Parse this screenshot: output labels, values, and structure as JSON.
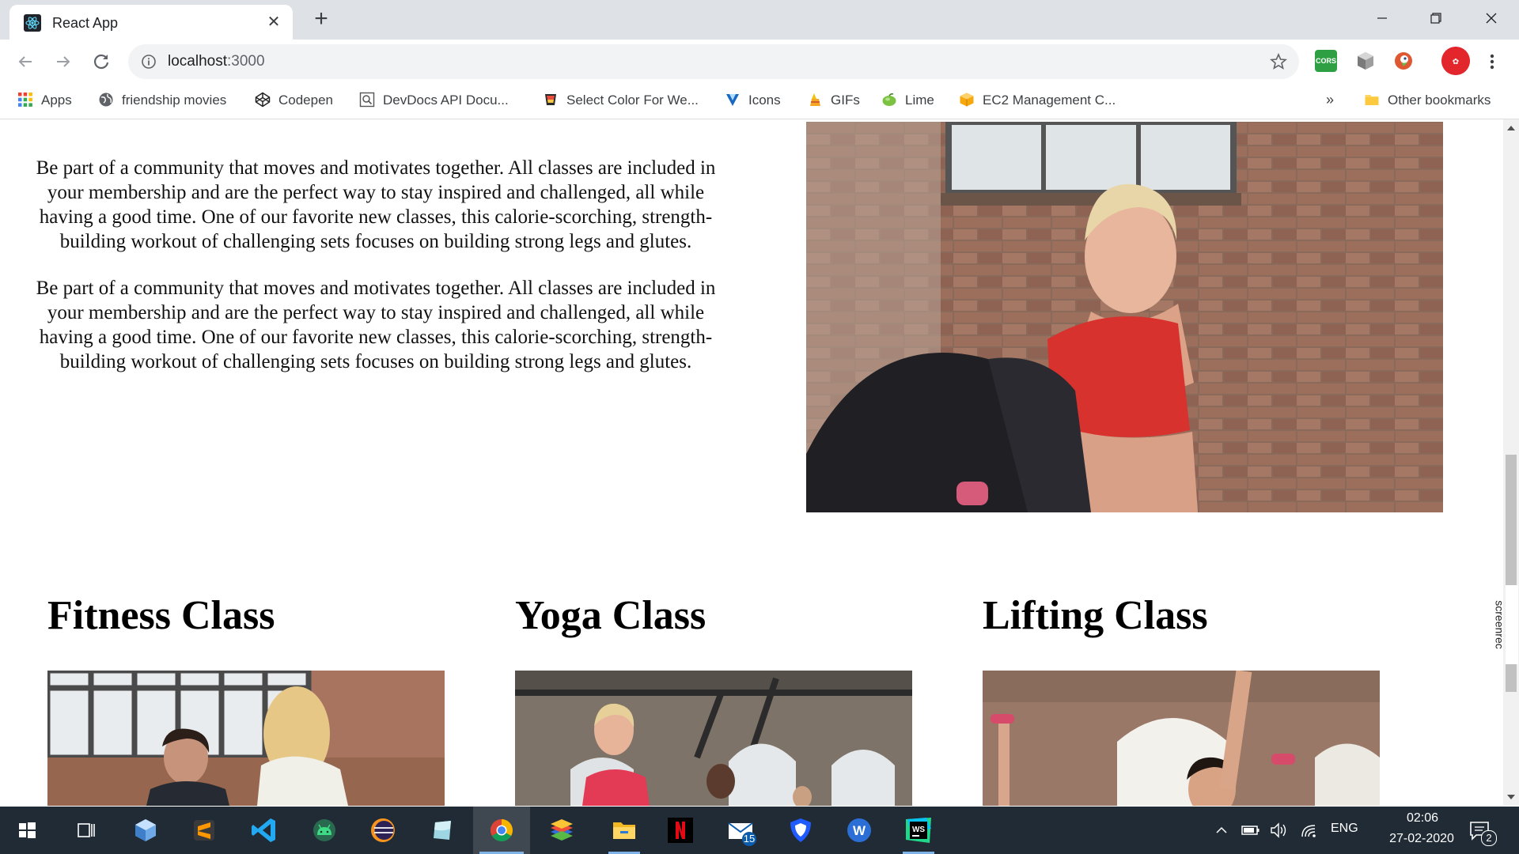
{
  "browser": {
    "tab_title": "React App",
    "url_host": "localhost",
    "url_port": ":3000"
  },
  "extensions": {
    "cors_label": "CORS"
  },
  "bookmarks": [
    {
      "label": "Apps",
      "icon": "apps-grid-icon"
    },
    {
      "label": "friendship movies",
      "icon": "globe-icon"
    },
    {
      "label": "Codepen",
      "icon": "codepen-icon"
    },
    {
      "label": "DevDocs API Docu...",
      "icon": "devdocs-icon"
    },
    {
      "label": "Select Color For We...",
      "icon": "color-picker-icon"
    },
    {
      "label": "Icons",
      "icon": "vuetify-icon"
    },
    {
      "label": "GIFs",
      "icon": "giphy-icon"
    },
    {
      "label": "Lime",
      "icon": "lime-icon"
    },
    {
      "label": "EC2 Management C...",
      "icon": "aws-box-icon"
    }
  ],
  "bookmarks_more": "»",
  "other_bookmarks": "Other bookmarks",
  "content": {
    "paragraph_1": "Be part of a community that moves and motivates together. All classes are included in your membership and are the perfect way to stay inspired and challenged, all while having a good time. One of our favorite new classes, this calorie-scorching, strength-building workout of challenging sets focuses on building strong legs and glutes.",
    "paragraph_2": "Be part of a community that moves and motivates together. All classes are included in your membership and are the perfect way to stay inspired and challenged, all while having a good time. One of our favorite new classes, this calorie-scorching, strength-building workout of challenging sets focuses on building strong legs and glutes.",
    "classes": [
      {
        "title": "Fitness Class"
      },
      {
        "title": "Yoga Class"
      },
      {
        "title": "Lifting Class"
      }
    ]
  },
  "screenrec_label": "screenrec",
  "taskbar": {
    "mail_badge": "15",
    "language": "ENG",
    "time": "02:06",
    "date": "27-02-2020",
    "notification_count": "2"
  },
  "colors": {
    "tabstrip": "#dee1e6",
    "taskbar": "#202b35",
    "accent": "#1a73e8"
  }
}
